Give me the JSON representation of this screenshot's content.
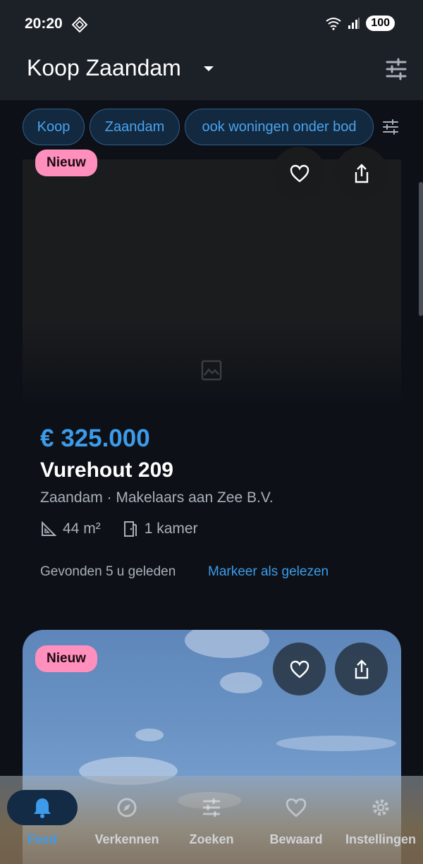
{
  "status_bar": {
    "time": "20:20",
    "battery": "100",
    "icons": [
      "diamond-icon",
      "wifi-icon",
      "signal-icon"
    ]
  },
  "header": {
    "title": "Koop Zaandam",
    "icons": [
      "dropdown-caret-icon",
      "tune-icon"
    ]
  },
  "filter_chips": [
    "Koop",
    "Zaandam",
    "ook woningen onder bod"
  ],
  "listings": [
    {
      "badge": "Nieuw",
      "price": "€ 325.000",
      "street": "Vurehout 209",
      "location": "Zaandam · Makelaars aan Zee B.V.",
      "area": "44 m²",
      "rooms": "1 kamer",
      "found": "Gevonden 5 u geleden",
      "mark_read": "Markeer als gelezen"
    },
    {
      "badge": "Nieuw"
    }
  ],
  "bottom_nav": {
    "items": [
      {
        "label": "Feed",
        "icon": "bell-icon",
        "active": true
      },
      {
        "label": "Verkennen",
        "icon": "explore-icon",
        "active": false
      },
      {
        "label": "Zoeken",
        "icon": "tune-icon",
        "active": false
      },
      {
        "label": "Bewaard",
        "icon": "heart-icon",
        "active": false
      },
      {
        "label": "Instellingen",
        "icon": "gear-icon",
        "active": false
      }
    ]
  },
  "colors": {
    "accent": "#3d9be9",
    "badge": "#ff8fbd",
    "background": "#0d1117",
    "app_bar": "#1c2128"
  }
}
